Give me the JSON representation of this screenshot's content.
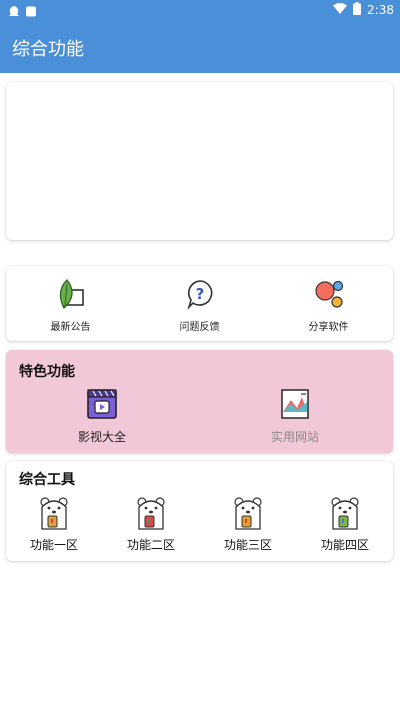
{
  "status_bar": {
    "time": "2:38"
  },
  "app_bar": {
    "title": "综合功能"
  },
  "quick_links": [
    {
      "label": "最新公告",
      "icon": "leaf-notice-icon"
    },
    {
      "label": "问题反馈",
      "icon": "question-bubble-icon"
    },
    {
      "label": "分享软件",
      "icon": "share-circles-icon"
    }
  ],
  "special": {
    "title": "特色功能",
    "background": "#f2c8d9",
    "items": [
      {
        "label": "影视大全",
        "icon": "video-player-icon",
        "color": "#222222"
      },
      {
        "label": "实用网站",
        "icon": "website-chart-icon",
        "color": "#8a8a8a"
      }
    ]
  },
  "tools": {
    "title": "综合工具",
    "items": [
      {
        "label": "功能一区",
        "icon": "bear-mascot-icon"
      },
      {
        "label": "功能二区",
        "icon": "bear-mascot-icon"
      },
      {
        "label": "功能三区",
        "icon": "bear-mascot-icon"
      },
      {
        "label": "功能四区",
        "icon": "bear-mascot-icon"
      }
    ]
  },
  "colors": {
    "primary": "#4a90d9"
  }
}
